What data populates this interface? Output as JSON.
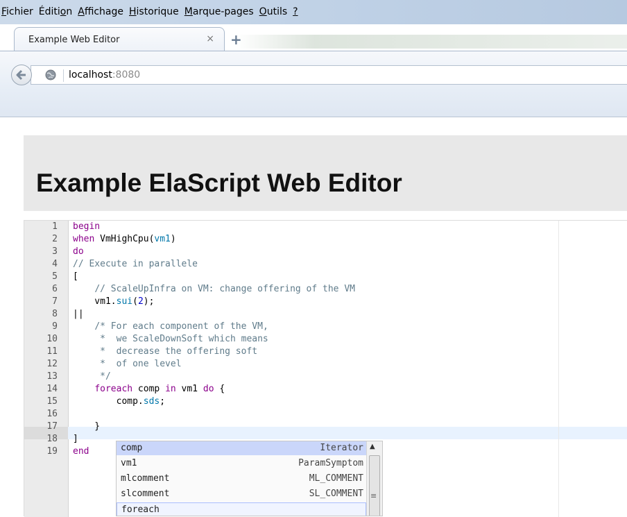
{
  "menubar": {
    "items": [
      {
        "key": "F",
        "rest": "ichier"
      },
      {
        "pre": "Éditi",
        "key": "o",
        "rest": "n"
      },
      {
        "key": "A",
        "rest": "ffichage"
      },
      {
        "key": "H",
        "rest": "istorique"
      },
      {
        "key": "M",
        "rest": "arque-pages"
      },
      {
        "key": "O",
        "rest": "utils"
      },
      {
        "key": "?",
        "rest": ""
      }
    ]
  },
  "tab": {
    "title": "Example Web Editor",
    "close": "×",
    "new_tab": "+"
  },
  "urlbar": {
    "host": "localhost",
    "port": ":8080"
  },
  "page": {
    "title": "Example ElaScript Web Editor"
  },
  "editor": {
    "line_numbers": [
      "1",
      "2",
      "3",
      "4",
      "5",
      "6",
      "7",
      "8",
      "9",
      "10",
      "11",
      "12",
      "13",
      "14",
      "15",
      "16",
      "17",
      "18",
      "19"
    ],
    "active_line": "16"
  },
  "autocomplete": {
    "items": [
      {
        "name": "comp",
        "meta": "Iterator"
      },
      {
        "name": "vm1",
        "meta": "ParamSymptom"
      },
      {
        "name": "mlcomment",
        "meta": "ML_COMMENT"
      },
      {
        "name": "slcomment",
        "meta": "SL_COMMENT"
      },
      {
        "name": "foreach",
        "meta": ""
      }
    ],
    "selected": "comp",
    "hovered": "foreach"
  }
}
